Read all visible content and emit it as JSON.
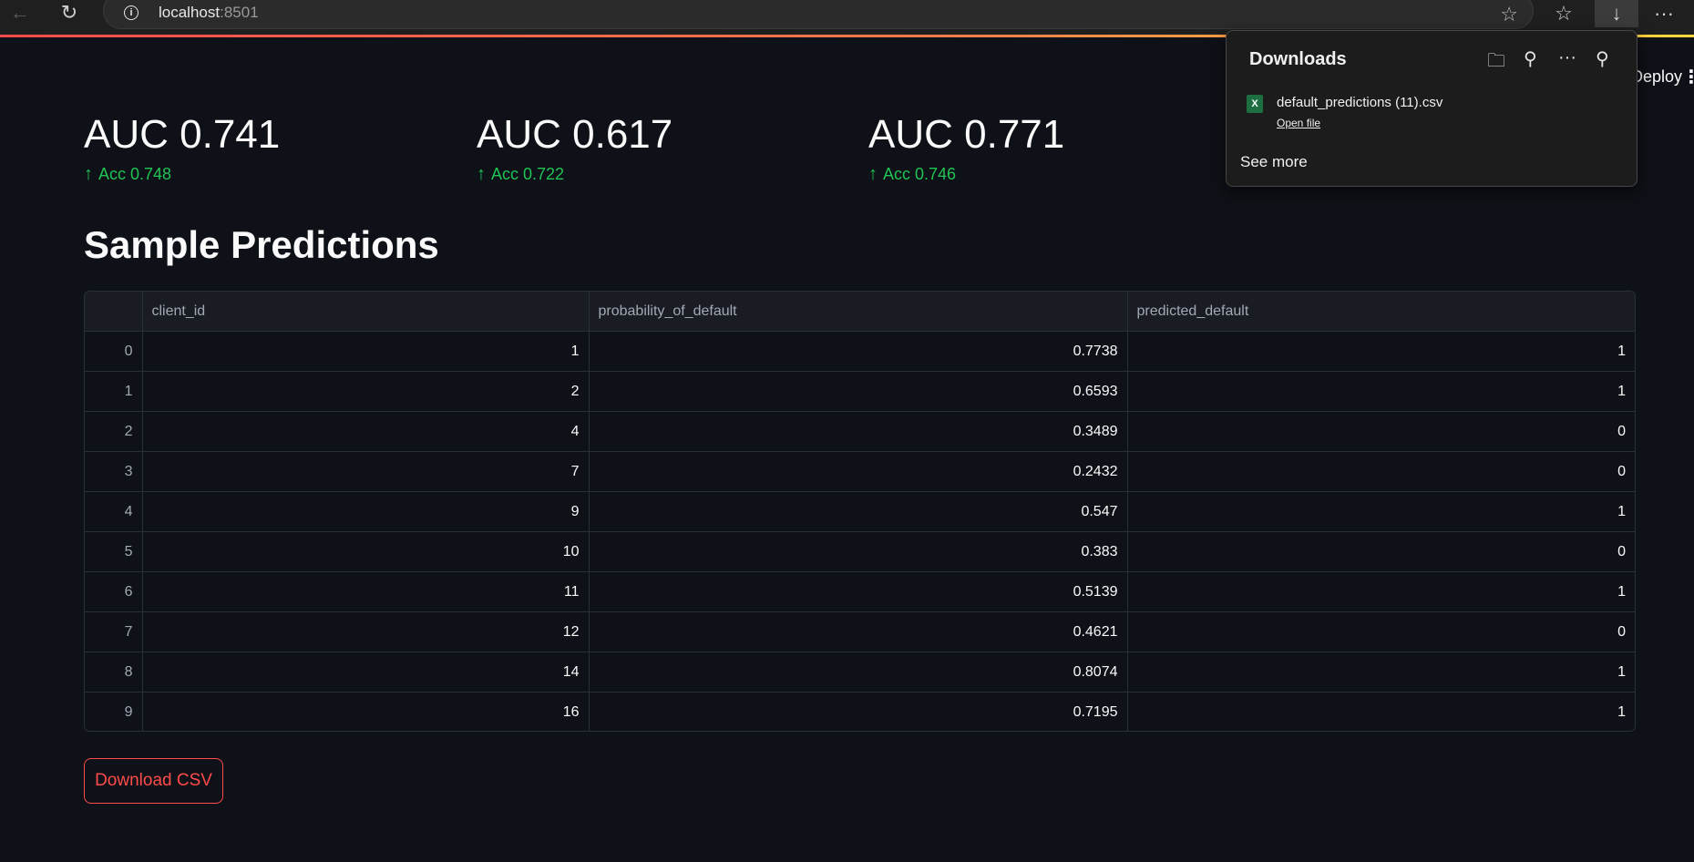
{
  "browser": {
    "url_host": "localhost",
    "url_port": ":8501",
    "toolbar_more": "···"
  },
  "app": {
    "deploy_label": "Deploy",
    "menu_label": "⋮"
  },
  "metrics": [
    {
      "value": "AUC 0.741",
      "delta": "Acc 0.748"
    },
    {
      "value": "AUC 0.617",
      "delta": "Acc 0.722"
    },
    {
      "value": "AUC 0.771",
      "delta": "Acc 0.746"
    }
  ],
  "section_title": "Sample Predictions",
  "table": {
    "columns": [
      "",
      "client_id",
      "probability_of_default",
      "predicted_default"
    ],
    "rows": [
      [
        "0",
        "1",
        "0.7738",
        "1"
      ],
      [
        "1",
        "2",
        "0.6593",
        "1"
      ],
      [
        "2",
        "4",
        "0.3489",
        "0"
      ],
      [
        "3",
        "7",
        "0.2432",
        "0"
      ],
      [
        "4",
        "9",
        "0.547",
        "1"
      ],
      [
        "5",
        "10",
        "0.383",
        "0"
      ],
      [
        "6",
        "11",
        "0.5139",
        "1"
      ],
      [
        "7",
        "12",
        "0.4621",
        "0"
      ],
      [
        "8",
        "14",
        "0.8074",
        "1"
      ],
      [
        "9",
        "16",
        "0.7195",
        "1"
      ]
    ]
  },
  "download_button": "Download CSV",
  "downloads_panel": {
    "title": "Downloads",
    "file_name": "default_predictions (11).csv",
    "open_file": "Open file",
    "see_more": "See more",
    "more_icon": "···",
    "file_icon_text": "X"
  },
  "colors": {
    "background": "#0e1117",
    "accent": "#ff4b4b",
    "delta_positive": "#21c354"
  }
}
